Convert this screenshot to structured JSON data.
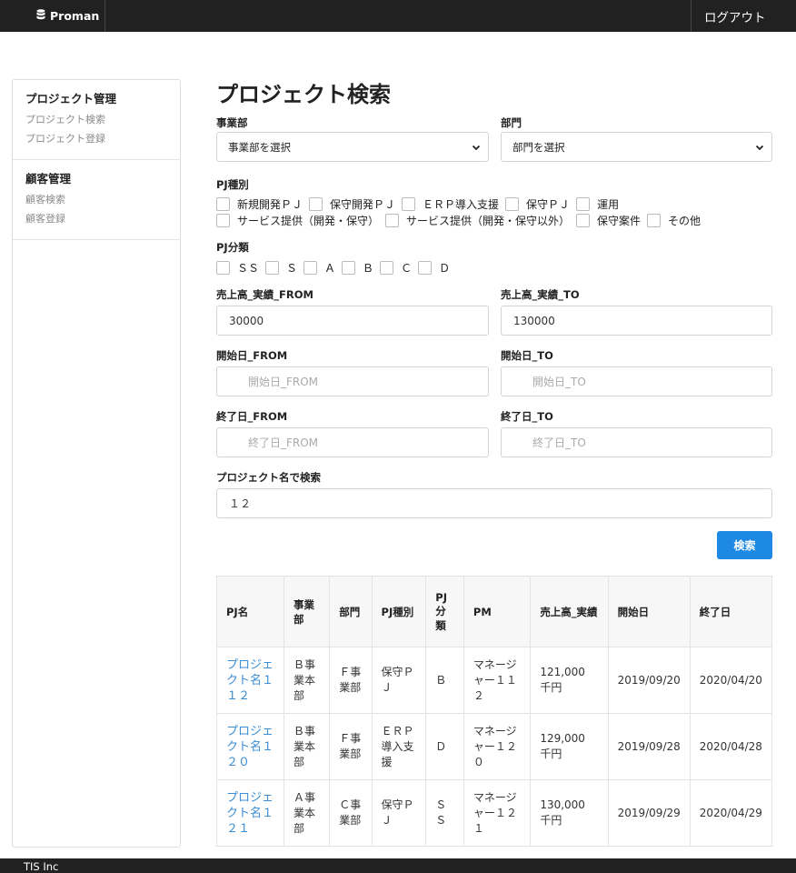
{
  "header": {
    "brand": "Proman",
    "logout": "ログアウト"
  },
  "sidebar": {
    "groups": [
      {
        "title": "プロジェクト管理",
        "items": [
          "プロジェクト検索",
          "プロジェクト登録"
        ]
      },
      {
        "title": "顧客管理",
        "items": [
          "顧客検索",
          "顧客登録"
        ]
      }
    ]
  },
  "page": {
    "title": "プロジェクト検索"
  },
  "form": {
    "division": {
      "label": "事業部",
      "value": "事業部を選択"
    },
    "department": {
      "label": "部門",
      "value": "部門を選択"
    },
    "pj_type": {
      "label": "PJ種別",
      "row1": [
        "新規開発ＰＪ",
        "保守開発ＰＪ",
        "ＥＲＰ導入支援",
        "保守ＰＪ",
        "運用"
      ],
      "row2": [
        "サービス提供（開発・保守）",
        "サービス提供（開発・保守以外）",
        "保守案件",
        "その他"
      ]
    },
    "pj_class": {
      "label": "PJ分類",
      "options": [
        "ＳＳ",
        "Ｓ",
        "Ａ",
        "Ｂ",
        "Ｃ",
        "Ｄ"
      ]
    },
    "sales_from": {
      "label": "売上高_実績_FROM",
      "value": "30000"
    },
    "sales_to": {
      "label": "売上高_実績_TO",
      "value": "130000"
    },
    "start_from": {
      "label": "開始日_FROM",
      "placeholder": "開始日_FROM"
    },
    "start_to": {
      "label": "開始日_TO",
      "placeholder": "開始日_TO"
    },
    "end_from": {
      "label": "終了日_FROM",
      "placeholder": "終了日_FROM"
    },
    "end_to": {
      "label": "終了日_TO",
      "placeholder": "終了日_TO"
    },
    "project_name": {
      "label": "プロジェクト名で検索",
      "value": "１２"
    },
    "search_button": "検索"
  },
  "table": {
    "headers": [
      "PJ名",
      "事業部",
      "部門",
      "PJ種別",
      "PJ分類",
      "PM",
      "売上高_実績",
      "開始日",
      "終了日"
    ],
    "rows": [
      [
        "プロジェクト名１１２",
        "Ｂ事業本部",
        "Ｆ事業部",
        "保守ＰＪ",
        "Ｂ",
        "マネージャー１１２",
        "121,000 千円",
        "2019/09/20",
        "2020/04/20"
      ],
      [
        "プロジェクト名１２０",
        "Ｂ事業本部",
        "Ｆ事業部",
        "ＥＲＰ導入支援",
        "Ｄ",
        "マネージャー１２０",
        "129,000 千円",
        "2019/09/28",
        "2020/04/28"
      ],
      [
        "プロジェクト名１２１",
        "Ａ事業本部",
        "Ｃ事業部",
        "保守ＰＪ",
        "ＳＳ",
        "マネージャー１２１",
        "130,000 千円",
        "2019/09/29",
        "2020/04/29"
      ]
    ]
  },
  "footer": {
    "text": "TIS Inc"
  }
}
